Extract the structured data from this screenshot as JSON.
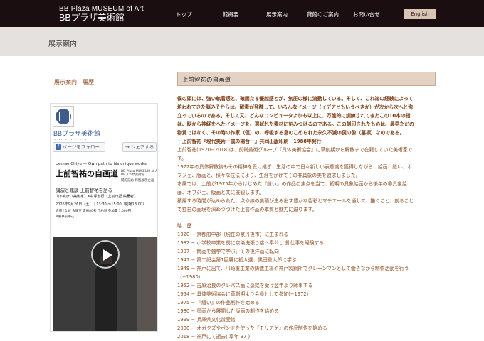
{
  "logo": {
    "en": "BB Plaza MUSEUM of Art",
    "jp": "BBプラザ美術館"
  },
  "nav": {
    "items": [
      "トップ",
      "館概要",
      "展示案内",
      "貸館のご案内",
      "お問い合せ"
    ],
    "lang_button": "English"
  },
  "page_title": "展示案内",
  "sidebar": {
    "title": "展示案内　履歴"
  },
  "facebook": {
    "page_name": "BBプラザ美術館",
    "followers": "1,107 フォロワー",
    "follow_label": "ページをフォロー",
    "share_label": "シェアする",
    "video": {
      "subtitle_en": "Uemae Chiyu — Own path to his unique works",
      "title_jp": "上前智祐の自画道",
      "badge": "BB Plaza MUSEUM of Art\nBBプラザ美術館",
      "org": "開館記念 特別展示企画",
      "lecture": "講演と鼎談 上前智祐を語る",
      "speakers": "山下克彦（美術家）X中塚宏行（上前日記 編著者）",
      "date": "2026年9月26日（土）｜13:30 〜15:00（開場13:00）",
      "place": "会場｜13F 会議室 定員80名 予約制 参加費 1,000円",
      "note": "※要事前申込"
    }
  },
  "content": {
    "heading": "上前智祐の自画道",
    "intro_bold": [
      "僕の頭には、強い執着感と、確固たる優越感とが、気圧の様に流動している。そして、これ迄の経験によって",
      "培われてきた脳みそからは、酵素が発酵して、いろんなイメージ（イデアともいうべきか）が次から次へと泡",
      "立っているのである。そして又、どんなコンピュータよりも以上に、万能的に訓練されてきたこの10本の指",
      "は、脳から神経をへたイメージを、選ばれた素材に刻みつけるのである。この刻印されたものは、最早ただの",
      "物質ではなく、その時の作家（僕）の、呼吸する息のこめられた永久不滅の僕の像（墓標）なのである。",
      "ー上前智祐『現代美術ー僕の場合ー』共同出版印刷　1988年発行"
    ],
    "bio": [
      "上前智祐(1920−2018)は、前衛美術グループ『具体美術協会』に草創期から解散まで在籍していた美術家で",
      "す。",
      "1972年の具体解散後もその精神を受け継ぎ、生活の中で日々新しい表意識を獲得しながら、絵画、縫い、オ",
      "ブジェ、版画と、様々な技法により、生涯をかけてその非具象の美を追求しました。",
      "本展では、上前が1975年からはじめた『縫い』の作品に焦点を当て、初期の具象絵画から後年の非具象絵",
      "画、オブジェ、版画と共に展観します。",
      "積層する時間が込められた、点や線の集積が生み出す豊かな色彩とマチエールを通して、描くこと、創ること",
      "で独自の画境を深めつづけた上前作品の本質と魅力に迫ります。"
    ],
    "history_title": "略　歴",
    "history": [
      "1920 − 京都府中郡（現在の京丹後市）に生まれる",
      "1932 − 小学校卒業を前に京染洗張り店へ奉公し 針仕事を経験する",
      "1937 − 南画を独学で学ぶ。その後洋画に転向",
      "1947 − 第二紀会第1回展に初入選、黒田重太郎に学ぶ",
      "1949 − 神戸に出て、川崎重工業の鋳造工場や神戸製鋼所でクレーンマンとして働きながら制作活動を行う",
      "（−1980）",
      "1952 − 吉原治良のクレパス画に感銘を受け翌年より師事する",
      "1954 − 具体美術協会に草創期より会員として参加(−1972）",
      "1975 − 『縫い』の作品制作を始める",
      "1980 − 墨画から展開した版画の制作を始める",
      "1999 − 兵庫県文化賞受賞",
      "2000 − オガクズやボンドを使った『モリアゲ』の作品制作を始める",
      "2018 − 神戸にて逝去( 享年 97 )"
    ]
  }
}
